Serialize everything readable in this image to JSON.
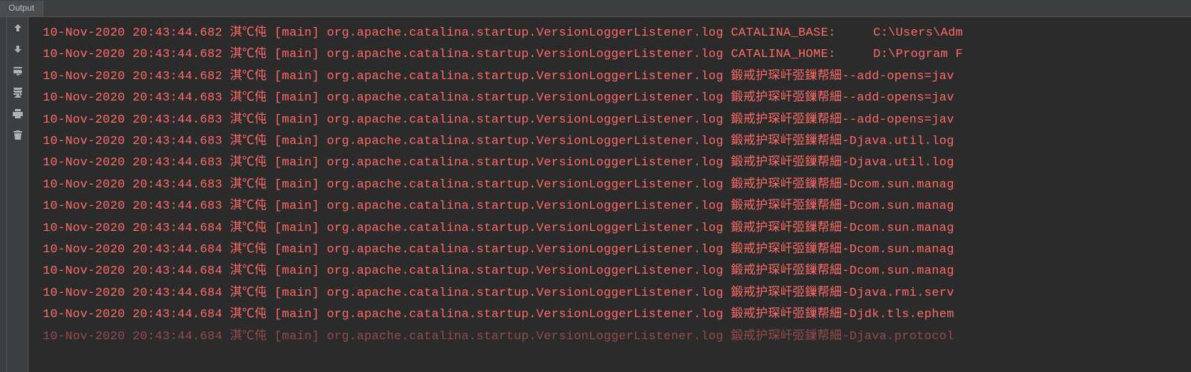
{
  "tab": {
    "label": "Output"
  },
  "log": {
    "lines": [
      "10-Nov-2020 20:43:44.682 淇℃伅 [main] org.apache.catalina.startup.VersionLoggerListener.log CATALINA_BASE:     C:\\Users\\Adm",
      "10-Nov-2020 20:43:44.682 淇℃伅 [main] org.apache.catalina.startup.VersionLoggerListener.log CATALINA_HOME:     D:\\Program F",
      "10-Nov-2020 20:43:44.682 淇℃伅 [main] org.apache.catalina.startup.VersionLoggerListener.log 鍛戒护琛屽弬鏁帮細--add-opens=jav",
      "10-Nov-2020 20:43:44.683 淇℃伅 [main] org.apache.catalina.startup.VersionLoggerListener.log 鍛戒护琛屽弬鏁帮細--add-opens=jav",
      "10-Nov-2020 20:43:44.683 淇℃伅 [main] org.apache.catalina.startup.VersionLoggerListener.log 鍛戒护琛屽弬鏁帮細--add-opens=jav",
      "10-Nov-2020 20:43:44.683 淇℃伅 [main] org.apache.catalina.startup.VersionLoggerListener.log 鍛戒护琛屽弬鏁帮細-Djava.util.log",
      "10-Nov-2020 20:43:44.683 淇℃伅 [main] org.apache.catalina.startup.VersionLoggerListener.log 鍛戒护琛屽弬鏁帮細-Djava.util.log",
      "10-Nov-2020 20:43:44.683 淇℃伅 [main] org.apache.catalina.startup.VersionLoggerListener.log 鍛戒护琛屽弬鏁帮細-Dcom.sun.manag",
      "10-Nov-2020 20:43:44.683 淇℃伅 [main] org.apache.catalina.startup.VersionLoggerListener.log 鍛戒护琛屽弬鏁帮細-Dcom.sun.manag",
      "10-Nov-2020 20:43:44.684 淇℃伅 [main] org.apache.catalina.startup.VersionLoggerListener.log 鍛戒护琛屽弬鏁帮細-Dcom.sun.manag",
      "10-Nov-2020 20:43:44.684 淇℃伅 [main] org.apache.catalina.startup.VersionLoggerListener.log 鍛戒护琛屽弬鏁帮細-Dcom.sun.manag",
      "10-Nov-2020 20:43:44.684 淇℃伅 [main] org.apache.catalina.startup.VersionLoggerListener.log 鍛戒护琛屽弬鏁帮細-Dcom.sun.manag",
      "10-Nov-2020 20:43:44.684 淇℃伅 [main] org.apache.catalina.startup.VersionLoggerListener.log 鍛戒护琛屽弬鏁帮細-Djava.rmi.serv",
      "10-Nov-2020 20:43:44.684 淇℃伅 [main] org.apache.catalina.startup.VersionLoggerListener.log 鍛戒护琛屽弬鏁帮細-Djdk.tls.ephem",
      "10-Nov-2020 20:43:44.684 淇℃伅 [main] org.apache.catalina.startup.VersionLoggerListener.log 鍛戒护琛屽弬鏁帮細-Djava.protocol"
    ]
  }
}
